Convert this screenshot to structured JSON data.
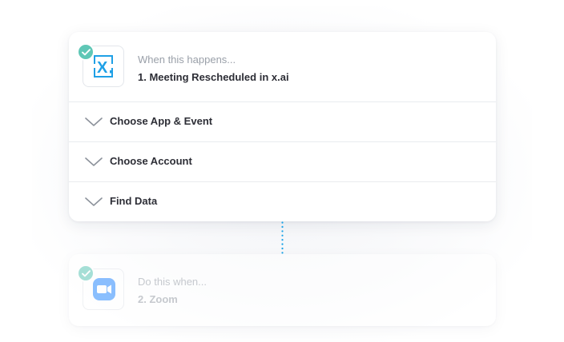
{
  "trigger": {
    "caption": "When this happens...",
    "title": "1. Meeting Rescheduled in x.ai",
    "app_icon": "x-ai-logo",
    "app_letter": "X.",
    "status_icon": "check-icon",
    "sections": [
      {
        "label": "Choose App & Event"
      },
      {
        "label": "Choose Account"
      },
      {
        "label": "Find Data"
      }
    ]
  },
  "action": {
    "caption": "Do this when...",
    "title": "2. Zoom",
    "app_icon": "zoom-video-icon",
    "status_icon": "check-icon"
  },
  "colors": {
    "accent_teal": "#5fc7b6",
    "xai_blue": "#1fa0e6",
    "zoom_blue": "#2d8cff",
    "connector_blue": "#1aa3e8",
    "text_dark": "#2d2e36",
    "text_muted": "#9aa0a9"
  }
}
